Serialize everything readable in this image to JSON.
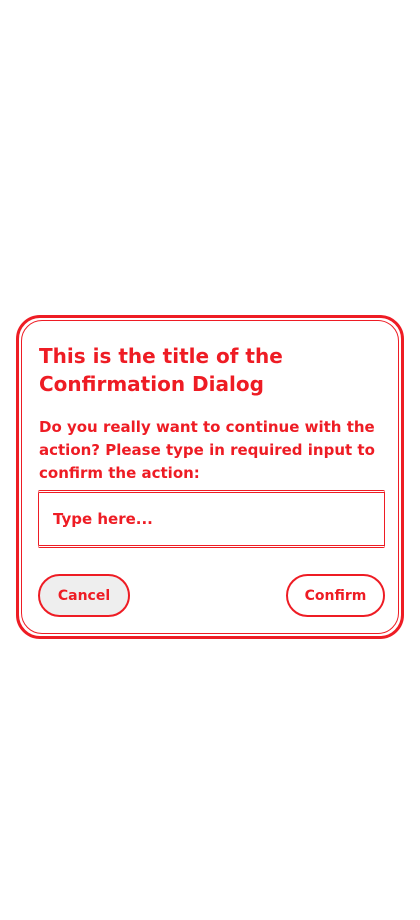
{
  "dialog": {
    "title": "This is the title of the Confirmation Dialog",
    "message": "Do you really want to continue with the action? Please type in required input to confirm the action:",
    "input": {
      "placeholder": "Type here...",
      "value": ""
    },
    "cancel_label": "Cancel",
    "confirm_label": "Confirm"
  },
  "colors": {
    "accent": "#ee1c24",
    "background": "#ffffff",
    "cancel_background": "#eeeeee"
  }
}
